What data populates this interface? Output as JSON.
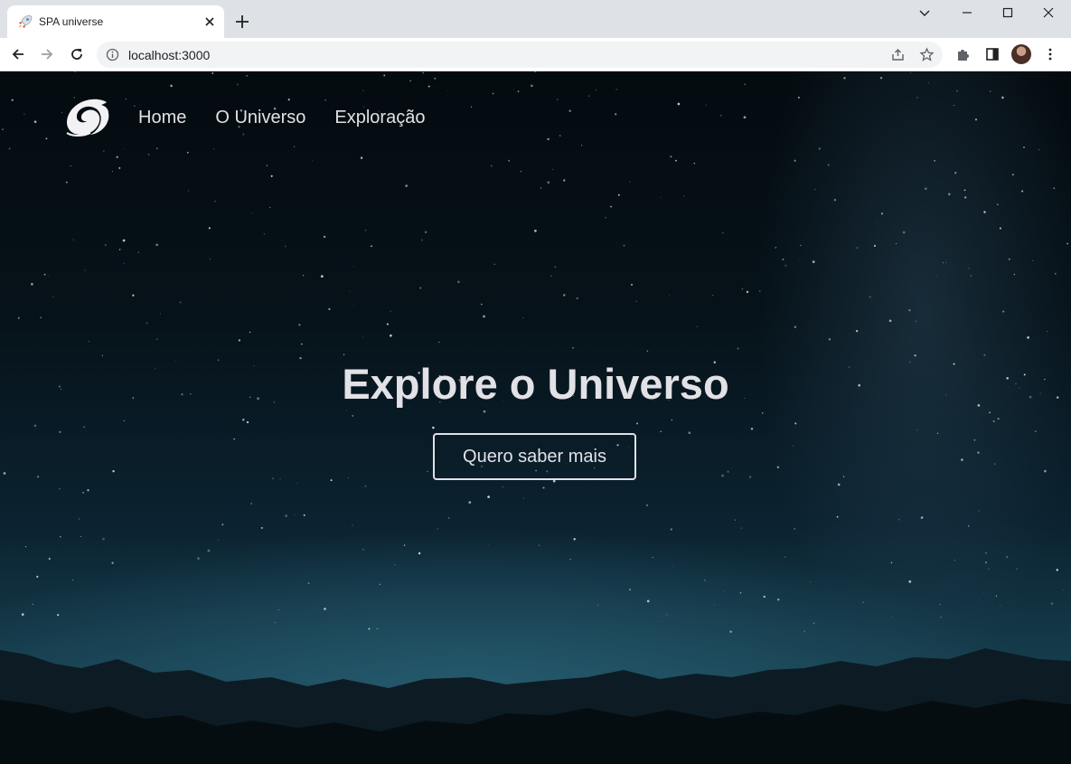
{
  "browser": {
    "tab": {
      "title": "SPA universe",
      "favicon": "rocket-icon"
    },
    "address_bar": {
      "url": "localhost:3000"
    },
    "colors": {
      "tabstrip": "#dee1e6",
      "toolbar": "#ffffff",
      "omnibox": "#f1f3f4"
    }
  },
  "page": {
    "logo": "spiral-galaxy-logo",
    "nav": {
      "items": [
        {
          "label": "Home"
        },
        {
          "label": "O Universo"
        },
        {
          "label": "Exploração"
        }
      ]
    },
    "hero": {
      "title": "Explore o Universo",
      "cta_label": "Quero saber mais"
    },
    "colors": {
      "text": "#e1e1e6",
      "background_top": "#040b10",
      "background_horizon": "#174050"
    }
  }
}
